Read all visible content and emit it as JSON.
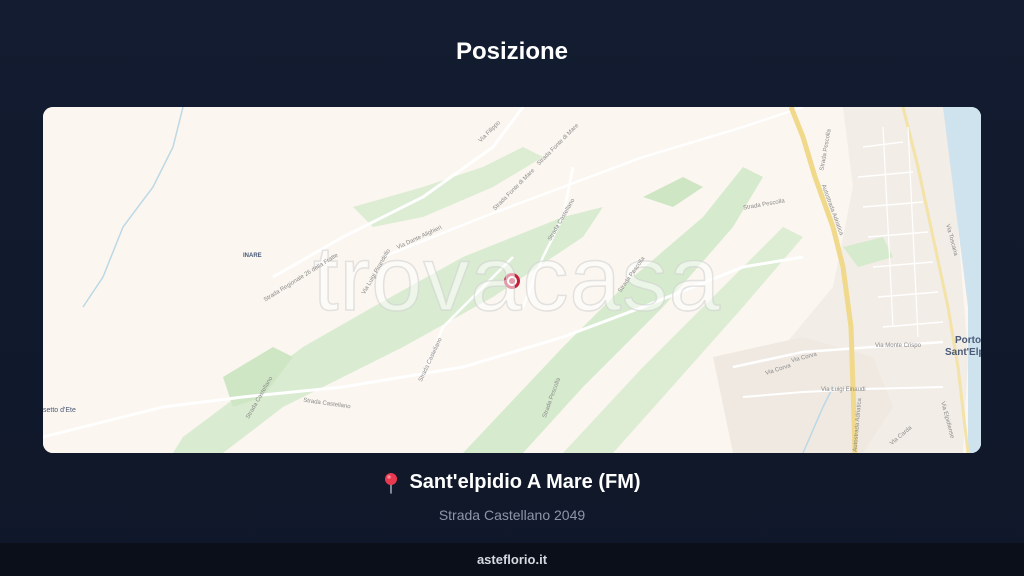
{
  "header": {
    "title": "Posizione"
  },
  "map": {
    "watermark": "trovacasa",
    "street_labels": {
      "sr": "Strada Regionale 26 della Fratte",
      "filippo": "Via Filippo",
      "fonte": "Strada Fonte di Mare",
      "fonte2": "Strada Fonte di Mare",
      "dante": "Via Dante Alighieri",
      "luigi": "Via Luigi Pirandello",
      "castellano1": "Strada Castellano",
      "castellano2": "Strada Castellano",
      "castellano3": "Strada Castellano",
      "castellano4": "Strada Castellano",
      "pescolla": "Strada Pescolla",
      "pescolla2": "Strada Pescolla",
      "pescolla3": "Strada Pescolla",
      "pescolla4": "Strada Pescolla",
      "autostrada": "Autostrada Adriatica",
      "autostrada2": "Autostrada Adriatica",
      "corva": "Via Corva",
      "corva2": "Via Corva",
      "crispo": "Via Monte Crispo",
      "einaudi": "Via Luigi Einaudi",
      "carda": "Via Carda",
      "toscana": "Via Toscana",
      "elpidiense": "Via Elpidiense"
    },
    "place_labels": {
      "porto": "Porto",
      "santelpidio": "Sant'Elpi",
      "casette": "setto d'Ete",
      "inare": "INARE"
    }
  },
  "location": {
    "city": "Sant'elpidio A Mare (FM)",
    "address": "Strada Castellano 2049"
  },
  "footer": {
    "brand": "asteflorio.it"
  },
  "colors": {
    "background": "#111a2e",
    "pin": "#c81e3c",
    "map_land": "#fbf6ef",
    "map_green": "#d9ecd1",
    "map_water": "#cfe3ee",
    "highway": "#f0d98a"
  },
  "icons": {
    "location_pin": "map-pin-icon",
    "map_marker": "map-marker-icon"
  }
}
